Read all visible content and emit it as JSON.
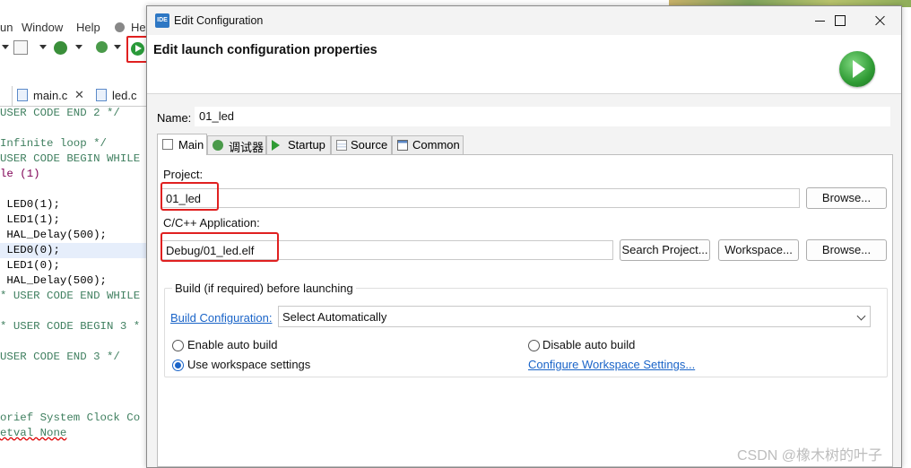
{
  "ide": {
    "menu": {
      "run": "un",
      "window": "Window",
      "help": "Help",
      "help2": "Hel"
    },
    "tabs": [
      {
        "label": "main.c"
      },
      {
        "label": "led.c"
      }
    ],
    "code": [
      "USER CODE END 2 */",
      "",
      "Infinite loop */",
      "USER CODE BEGIN WHILE",
      "le (1)",
      "",
      " LED0(1);",
      " LED1(1);",
      " HAL_Delay(500);",
      " LED0(0);",
      " LED1(0);",
      " HAL_Delay(500);",
      "* USER CODE END WHILE",
      "",
      "* USER CODE BEGIN 3 *",
      "",
      "USER CODE END 3 */",
      "",
      "",
      "",
      "",
      "orief System Clock Co",
      "etval None"
    ]
  },
  "dialog": {
    "window_title": "Edit Configuration",
    "app_icon_text": "IDE",
    "header_title": "Edit launch configuration properties",
    "name_label": "Name:",
    "name_value": "01_led",
    "tabs": [
      {
        "label": "Main",
        "icon": "document-icon"
      },
      {
        "label": "调试器",
        "icon": "debugger-icon"
      },
      {
        "label": "Startup",
        "icon": "startup-play-icon"
      },
      {
        "label": "Source",
        "icon": "source-icon"
      },
      {
        "label": "Common",
        "icon": "common-icon"
      }
    ],
    "main": {
      "project_label": "Project:",
      "project_value": "01_led",
      "project_browse": "Browse...",
      "app_label": "C/C++ Application:",
      "app_value": "Debug/01_led.elf",
      "search_project": "Search Project...",
      "workspace": "Workspace...",
      "app_browse": "Browse...",
      "build_group_title": "Build (if required) before launching",
      "build_config_label": "Build Configuration:",
      "build_config_value": "Select Automatically",
      "enable_auto_build": "Enable auto build",
      "disable_auto_build": "Disable auto build",
      "use_workspace_settings": "Use workspace settings",
      "configure_workspace": "Configure Workspace Settings...",
      "selected_radio": "use_workspace_settings"
    }
  },
  "watermark": "CSDN @橡木树的叶子",
  "colors": {
    "highlight_red": "#e02020",
    "link_blue": "#1a64c8",
    "run_green": "#2f9b34"
  }
}
